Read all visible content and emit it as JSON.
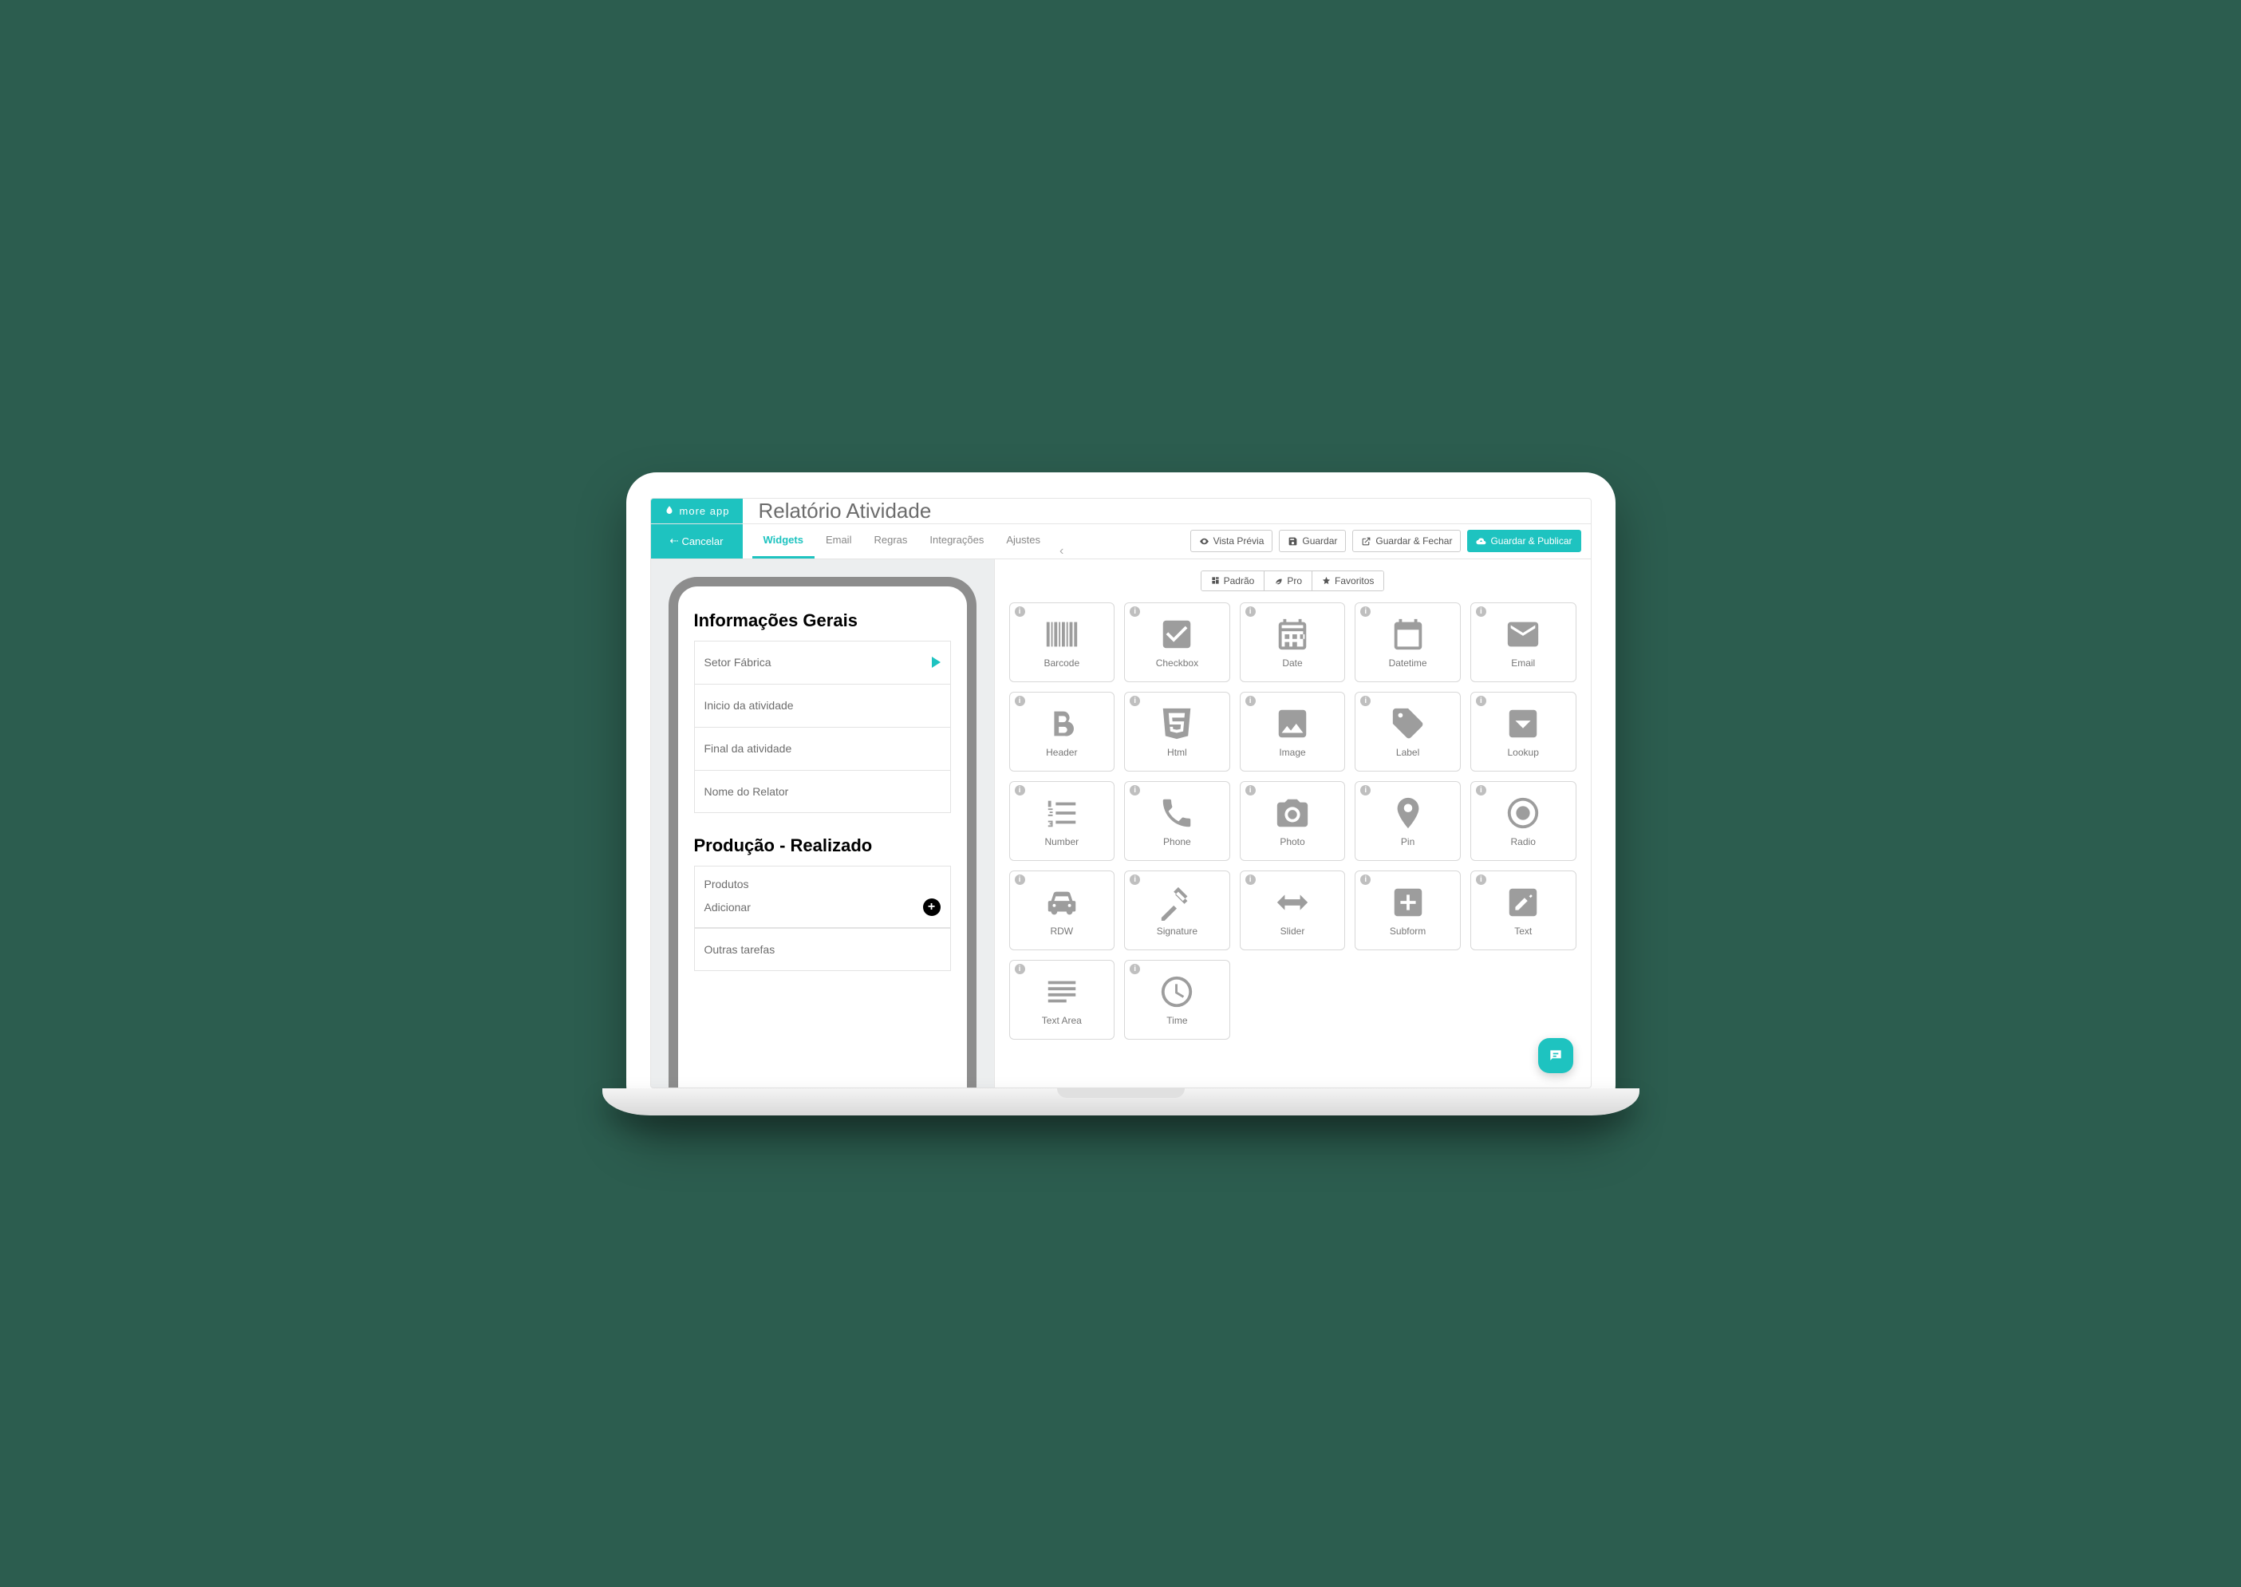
{
  "brand": "more app",
  "page_title": "Relatório Atividade",
  "cancel_label": "Cancelar",
  "tabs": {
    "widgets": "Widgets",
    "email": "Email",
    "regras": "Regras",
    "integracoes": "Integrações",
    "ajustes": "Ajustes"
  },
  "actions": {
    "preview": "Vista Prévia",
    "save": "Guardar",
    "save_close": "Guardar & Fechar",
    "save_publish": "Guardar & Publicar"
  },
  "filters": {
    "padrao": "Padrão",
    "pro": "Pro",
    "favoritos": "Favoritos"
  },
  "form": {
    "section1_title": "Informações Gerais",
    "setor_fabrica": "Setor Fábrica",
    "inicio": "Inicio da atividade",
    "final": "Final da atividade",
    "nome_relator": "Nome do Relator",
    "section2_title": "Produção - Realizado",
    "produtos": "Produtos",
    "adicionar": "Adicionar",
    "outras_tarefas": "Outras tarefas"
  },
  "widgets": {
    "barcode": "Barcode",
    "checkbox": "Checkbox",
    "date": "Date",
    "datetime": "Datetime",
    "email": "Email",
    "header": "Header",
    "html": "Html",
    "image": "Image",
    "label": "Label",
    "lookup": "Lookup",
    "number": "Number",
    "phone": "Phone",
    "photo": "Photo",
    "pin": "Pin",
    "radio": "Radio",
    "rdw": "RDW",
    "signature": "Signature",
    "slider": "Slider",
    "subform": "Subform",
    "text": "Text",
    "textarea": "Text Area",
    "time": "Time"
  }
}
